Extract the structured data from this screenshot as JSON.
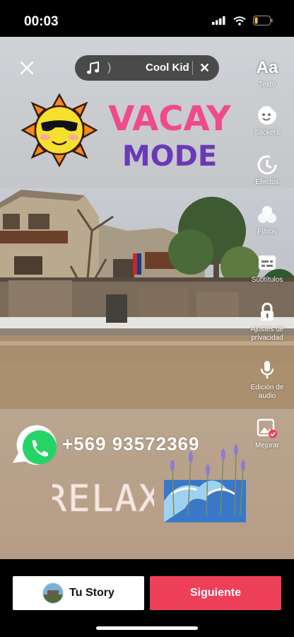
{
  "status_bar": {
    "time": "00:03",
    "battery_level": 0.2
  },
  "editor": {
    "music": {
      "title": "Cool Kid",
      "paren": ")"
    },
    "tools": [
      {
        "label": "Texto",
        "icon": "text-icon"
      },
      {
        "label": "Stickers",
        "icon": "sticker-icon"
      },
      {
        "label": "Efectos",
        "icon": "effects-icon"
      },
      {
        "label": "Filtros",
        "icon": "filters-icon"
      },
      {
        "label": "Subtítulos",
        "icon": "captions-icon"
      },
      {
        "label": "Ajustes de privacidad",
        "icon": "lock-icon"
      },
      {
        "label": "Edición de audio",
        "icon": "mic-icon"
      },
      {
        "label": "Mejorar",
        "icon": "enhance-icon"
      }
    ],
    "text_icon_glyph": "Aa"
  },
  "stickers": {
    "vacay_line1": "VACAY",
    "vacay_line2": "MODE",
    "phone": "+569  93572369",
    "relax": "RELAX"
  },
  "bottom": {
    "story_label": "Tu Story",
    "next_label": "Siguiente"
  },
  "colors": {
    "accent": "#ee3f59",
    "whatsapp": "#25d366"
  }
}
